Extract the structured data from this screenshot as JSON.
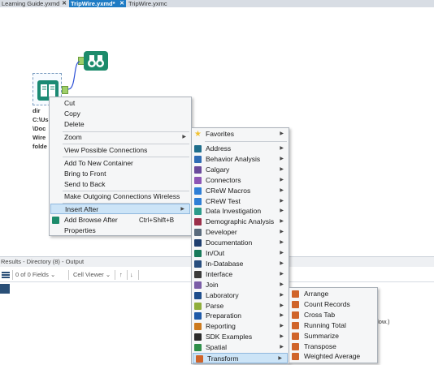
{
  "tabs": [
    {
      "label": "Learning Guide.yxmd",
      "active": false
    },
    {
      "label": "TripWire.yxmd*",
      "active": true
    },
    {
      "label": "TripWire.yxmc",
      "active": false
    }
  ],
  "canvas": {
    "directory_tool_text": [
      "dir",
      "C:\\Us",
      "\\Doc",
      "Wire",
      "folde"
    ]
  },
  "context_menu": {
    "cut": "Cut",
    "copy": "Copy",
    "delete": "Delete",
    "zoom": "Zoom",
    "view_possible_connections": "View Possible Connections",
    "add_to_new_container": "Add To New Container",
    "bring_to_front": "Bring to Front",
    "send_to_back": "Send to Back",
    "make_outgoing_wireless": "Make Outgoing Connections Wireless",
    "insert_after": "Insert After",
    "add_browse_after": "Add Browse After",
    "add_browse_after_shortcut": "Ctrl+Shift+B",
    "properties": "Properties"
  },
  "categories_menu": {
    "items": [
      {
        "label": "Favorites",
        "icon": "star-icon",
        "color": "#f2c230"
      },
      {
        "label": "Address",
        "icon": "address-icon",
        "color": "#1f6e8c"
      },
      {
        "label": "Behavior Analysis",
        "icon": "behavior-analysis-icon",
        "color": "#2f6db5"
      },
      {
        "label": "Calgary",
        "icon": "calgary-icon",
        "color": "#6a4a9c"
      },
      {
        "label": "Connectors",
        "icon": "connectors-icon",
        "color": "#8d56b6"
      },
      {
        "label": "CReW Macros",
        "icon": "crew-macros-icon",
        "color": "#2f7fd6"
      },
      {
        "label": "CReW Test",
        "icon": "crew-test-icon",
        "color": "#2f7fd6"
      },
      {
        "label": "Data Investigation",
        "icon": "data-investigation-icon",
        "color": "#2c9b8a"
      },
      {
        "label": "Demographic Analysis",
        "icon": "demographic-analysis-icon",
        "color": "#9b2f4a"
      },
      {
        "label": "Developer",
        "icon": "developer-icon",
        "color": "#5a6b7d"
      },
      {
        "label": "Documentation",
        "icon": "documentation-icon",
        "color": "#1e3e6e"
      },
      {
        "label": "In/Out",
        "icon": "in-out-icon",
        "color": "#187a5a"
      },
      {
        "label": "In-Database",
        "icon": "in-database-icon",
        "color": "#284e7e"
      },
      {
        "label": "Interface",
        "icon": "interface-icon",
        "color": "#3b3b3b"
      },
      {
        "label": "Join",
        "icon": "join-icon",
        "color": "#7b5ea7"
      },
      {
        "label": "Laboratory",
        "icon": "laboratory-icon",
        "color": "#1f4e8c"
      },
      {
        "label": "Parse",
        "icon": "parse-icon",
        "color": "#8fae3c"
      },
      {
        "label": "Preparation",
        "icon": "preparation-icon",
        "color": "#1f5aa8"
      },
      {
        "label": "Reporting",
        "icon": "reporting-icon",
        "color": "#cc7a1e"
      },
      {
        "label": "SDK Examples",
        "icon": "sdk-examples-icon",
        "color": "#2b2b2b"
      },
      {
        "label": "Spatial",
        "icon": "spatial-icon",
        "color": "#2f8f4a"
      },
      {
        "label": "Transform",
        "icon": "transform-icon",
        "color": "#d0642a"
      }
    ]
  },
  "transform_menu": {
    "items": [
      {
        "label": "Arrange",
        "icon": "arrange-icon"
      },
      {
        "label": "Count Records",
        "icon": "count-records-icon"
      },
      {
        "label": "Cross Tab",
        "icon": "cross-tab-icon"
      },
      {
        "label": "Running Total",
        "icon": "running-total-icon"
      },
      {
        "label": "Summarize",
        "icon": "summarize-icon"
      },
      {
        "label": "Transpose",
        "icon": "transpose-icon"
      },
      {
        "label": "Weighted Average",
        "icon": "weighted-average-icon"
      }
    ],
    "icon_color": "#d0642a"
  },
  "results": {
    "header": "Results - Directory (8) - Output",
    "fields": "0 of 0 Fields",
    "cell_viewer": "Cell Viewer",
    "up": "↑",
    "down": "↓",
    "flow_text": "flow.)"
  },
  "colors": {
    "accent": "#1e7bc4",
    "menu_highlight": "#cce4f7"
  }
}
